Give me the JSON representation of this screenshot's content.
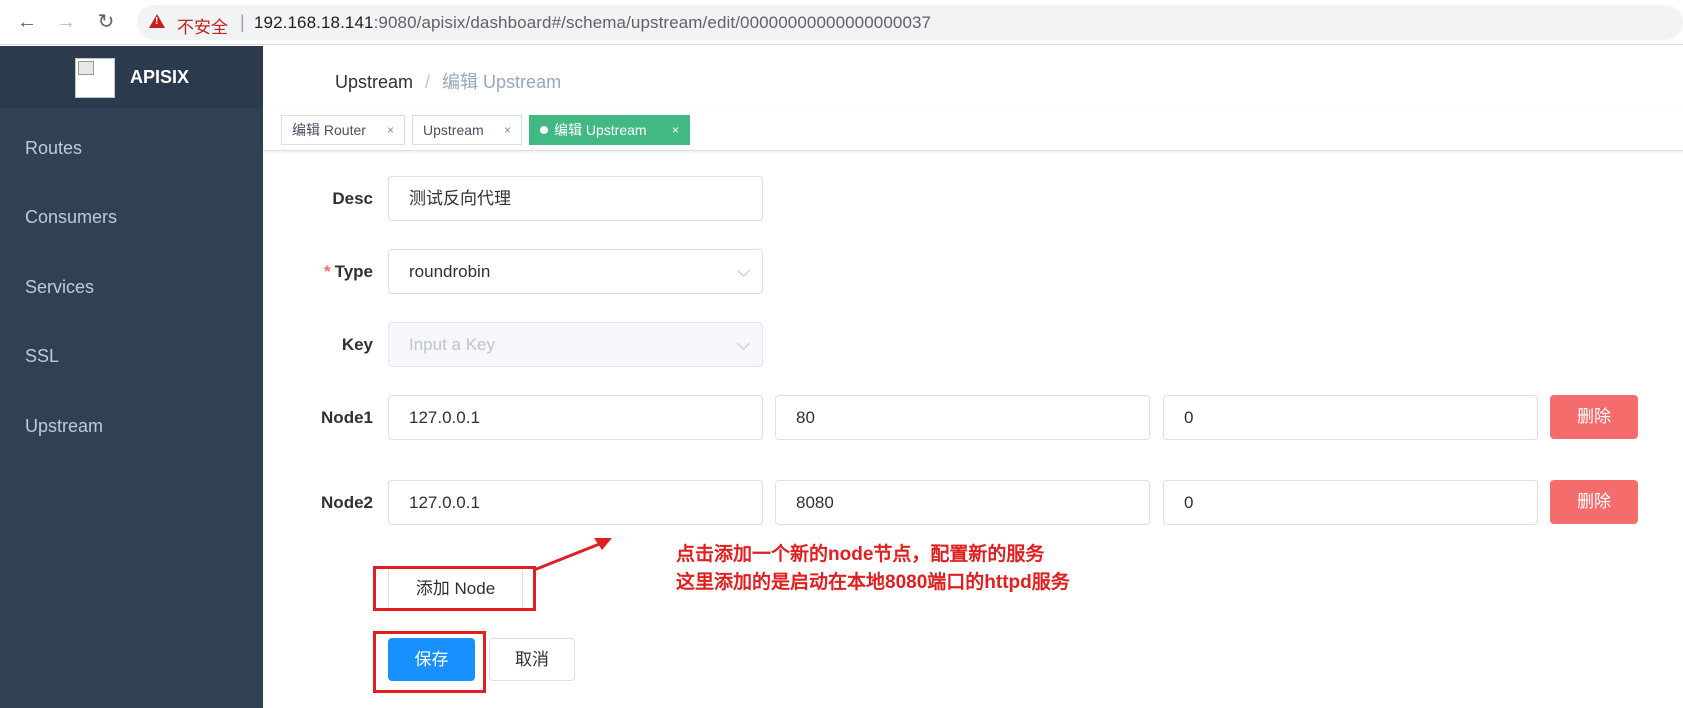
{
  "browser": {
    "insecure_label": "不安全",
    "url_host": "192.168.18.141",
    "url_rest": ":9080/apisix/dashboard#/schema/upstream/edit/00000000000000000037"
  },
  "sidebar": {
    "title": "APISIX",
    "items": [
      {
        "label": "Routes"
      },
      {
        "label": "Consumers"
      },
      {
        "label": "Services"
      },
      {
        "label": "SSL"
      },
      {
        "label": "Upstream"
      }
    ]
  },
  "breadcrumb": {
    "parent": "Upstream",
    "separator": "/",
    "current": "编辑 Upstream"
  },
  "tags": [
    {
      "label": "编辑 Router",
      "close": "×"
    },
    {
      "label": "Upstream",
      "close": "×"
    },
    {
      "label": "编辑 Upstream",
      "close": "×"
    }
  ],
  "form": {
    "desc_label": "Desc",
    "desc_value": "测试反向代理",
    "type_required": "*",
    "type_label": "Type",
    "type_value": "roundrobin",
    "key_label": "Key",
    "key_placeholder": "Input a Key",
    "nodes": [
      {
        "label": "Node1",
        "host": "127.0.0.1",
        "port": "80",
        "weight": "0",
        "delete_label": "删除"
      },
      {
        "label": "Node2",
        "host": "127.0.0.1",
        "port": "8080",
        "weight": "0",
        "delete_label": "删除"
      }
    ],
    "add_node_label": "添加 Node",
    "save_label": "保存",
    "cancel_label": "取消"
  },
  "annotation": {
    "line1": "点击添加一个新的node节点，配置新的服务",
    "line2": "这里添加的是启动在本地8080端口的httpd服务"
  },
  "colors": {
    "sidebar_bg": "#304156",
    "active_tag": "#42b983",
    "primary": "#1890ff",
    "danger": "#f56c6c",
    "annotation": "#e02020"
  }
}
